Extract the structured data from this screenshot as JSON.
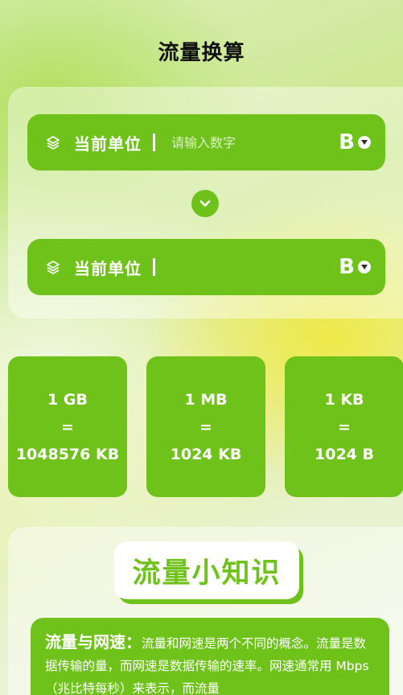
{
  "header": {
    "title": "流量换算"
  },
  "converter": {
    "from": {
      "label": "当前单位",
      "placeholder": "请输入数字",
      "value": "",
      "unit": "B"
    },
    "to": {
      "label": "当前单位",
      "value": "",
      "unit": "B"
    }
  },
  "cards": [
    {
      "top": "1 GB",
      "eq": "=",
      "bottom": "1048576 KB"
    },
    {
      "top": "1 MB",
      "eq": "=",
      "bottom": "1024 KB"
    },
    {
      "top": "1 KB",
      "eq": "=",
      "bottom": "1024 B"
    }
  ],
  "knowledge": {
    "title": "流量小知识",
    "heading": "流量与网速：",
    "body": "流量和网速是两个不同的概念。流量是数据传输的量，而网速是数据传输的速率。网速通常用 Mbps（兆比特每秒）来表示，而流量"
  },
  "colors": {
    "accent": "#6fc21a",
    "text": "#111111"
  }
}
